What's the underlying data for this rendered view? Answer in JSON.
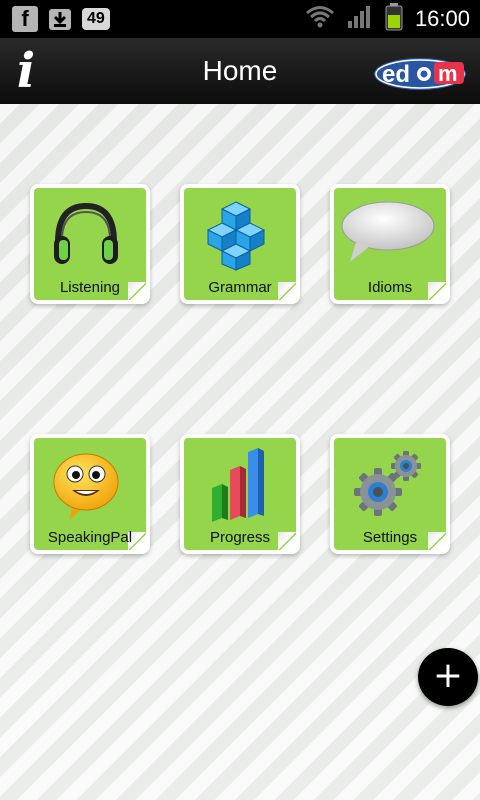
{
  "status_bar": {
    "facebook_letter": "f",
    "notification_count": "49",
    "time": "16:00",
    "icons": [
      "facebook-icon",
      "download-icon",
      "wifi-icon",
      "signal-icon",
      "battery-icon"
    ]
  },
  "header": {
    "info_label": "i",
    "title": "Home",
    "logo_text": [
      "ed",
      "o",
      "m"
    ]
  },
  "tiles": [
    {
      "label": "Listening",
      "icon": "headphones-icon"
    },
    {
      "label": "Grammar",
      "icon": "blocks-icon"
    },
    {
      "label": "Idioms",
      "icon": "speech-bubble-icon"
    },
    {
      "label": "SpeakingPal",
      "icon": "smiley-icon"
    },
    {
      "label": "Progress",
      "icon": "bar-chart-icon"
    },
    {
      "label": "Settings",
      "icon": "gears-icon"
    }
  ],
  "fab": {
    "label": "+"
  },
  "colors": {
    "tile_green": "#94d54b",
    "title_bar": "#111111",
    "status_bar": "#000000"
  }
}
